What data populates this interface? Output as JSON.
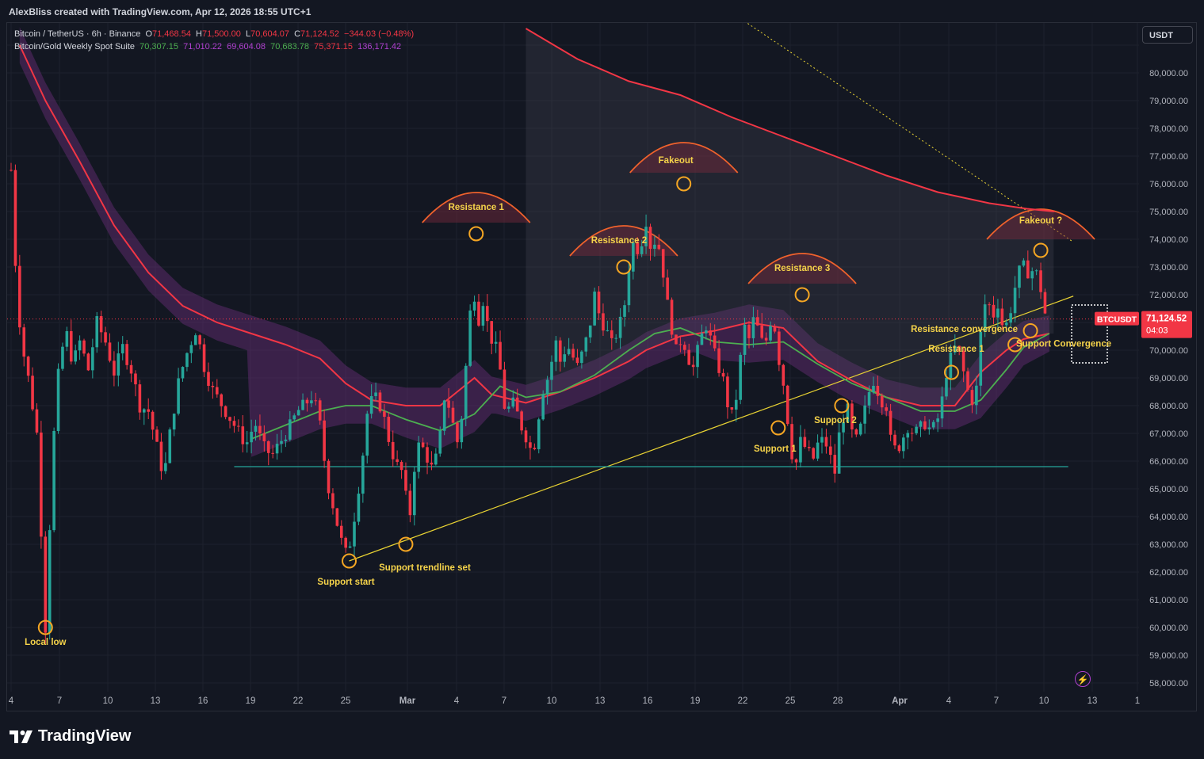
{
  "header": {
    "attribution": "AlexBliss created with TradingView.com, Apr 12, 2026 18:55 UTC+1"
  },
  "legend": {
    "symbol_line": "Bitcoin / TetherUS · 6h · Binance",
    "ohlc": {
      "o_label": "O",
      "o": "71,468.54",
      "h_label": "H",
      "h": "71,500.00",
      "l_label": "L",
      "l": "70,604.07",
      "c_label": "C",
      "c": "71,124.52",
      "change": "−344.03 (−0.48%)"
    },
    "indicator_name": "Bitcoin/Gold Weekly Spot Suite",
    "indicator_values": [
      "70,307.15",
      "71,010.22",
      "69,604.08",
      "70,683.78",
      "75,371.15",
      "136,171.42"
    ]
  },
  "currency_button": "USDT",
  "branding": "TradingView",
  "chart_data": {
    "type": "candlestick",
    "symbol": "BTCUSDT",
    "timeframe": "6h",
    "ylim": [
      57500,
      81700
    ],
    "y_ticks": [
      "58,000.00",
      "59,000.00",
      "60,000.00",
      "61,000.00",
      "62,000.00",
      "63,000.00",
      "64,000.00",
      "65,000.00",
      "66,000.00",
      "67,000.00",
      "68,000.00",
      "69,000.00",
      "70,000.00",
      "71,000.00",
      "72,000.00",
      "73,000.00",
      "74,000.00",
      "75,000.00",
      "76,000.00",
      "77,000.00",
      "78,000.00",
      "79,000.00",
      "80,000.00"
    ],
    "x_ticks": [
      "4",
      "7",
      "10",
      "13",
      "16",
      "19",
      "22",
      "25",
      "Mar",
      "4",
      "7",
      "10",
      "13",
      "16",
      "19",
      "22",
      "25",
      "28",
      "Apr",
      "4",
      "7",
      "10",
      "13",
      "1"
    ],
    "last_price": {
      "label": "BTCUSDT",
      "value": "71,124.52",
      "countdown": "04:03",
      "price": 71124.52
    },
    "close_path": [
      [
        4.0,
        76500
      ],
      [
        4.3,
        72500
      ],
      [
        4.6,
        70300
      ],
      [
        5.0,
        69000
      ],
      [
        5.5,
        67000
      ],
      [
        5.8,
        62800
      ],
      [
        6.0,
        60000
      ],
      [
        6.2,
        63000
      ],
      [
        6.5,
        67000
      ],
      [
        6.8,
        69500
      ],
      [
        7.2,
        70700
      ],
      [
        7.6,
        69500
      ],
      [
        8.0,
        70300
      ],
      [
        8.5,
        69300
      ],
      [
        9.0,
        71000
      ],
      [
        9.5,
        70300
      ],
      [
        10.0,
        69200
      ],
      [
        10.5,
        70100
      ],
      [
        11.0,
        69300
      ],
      [
        11.5,
        68000
      ],
      [
        12.0,
        67800
      ],
      [
        12.5,
        66500
      ],
      [
        12.9,
        65400
      ],
      [
        13.3,
        67200
      ],
      [
        13.8,
        69000
      ],
      [
        14.3,
        70000
      ],
      [
        14.8,
        70800
      ],
      [
        15.2,
        69500
      ],
      [
        15.7,
        68600
      ],
      [
        16.2,
        68100
      ],
      [
        16.7,
        67600
      ],
      [
        17.2,
        67100
      ],
      [
        17.7,
        66600
      ],
      [
        18.2,
        67400
      ],
      [
        18.7,
        66500
      ],
      [
        19.2,
        66200
      ],
      [
        19.7,
        66700
      ],
      [
        20.2,
        67200
      ],
      [
        20.7,
        67800
      ],
      [
        21.2,
        68100
      ],
      [
        21.6,
        68400
      ],
      [
        22.0,
        67300
      ],
      [
        22.4,
        65300
      ],
      [
        22.8,
        64300
      ],
      [
        23.2,
        63200
      ],
      [
        23.6,
        62500
      ],
      [
        24.0,
        64000
      ],
      [
        24.4,
        65700
      ],
      [
        24.8,
        68000
      ],
      [
        25.2,
        68300
      ],
      [
        25.6,
        67900
      ],
      [
        26.0,
        66800
      ],
      [
        26.4,
        65900
      ],
      [
        26.8,
        65600
      ],
      [
        27.2,
        63800
      ],
      [
        27.5,
        65800
      ],
      [
        27.8,
        66700
      ],
      [
        28.2,
        66200
      ],
      [
        28.6,
        65600
      ],
      [
        29.0,
        66900
      ],
      [
        29.3,
        68600
      ],
      [
        29.6,
        67700
      ],
      [
        30.0,
        66700
      ],
      [
        30.3,
        67800
      ],
      [
        30.6,
        70200
      ],
      [
        30.9,
        72500
      ],
      [
        31.2,
        71000
      ],
      [
        31.5,
        71800
      ],
      [
        31.8,
        70800
      ],
      [
        32.1,
        70200
      ],
      [
        32.4,
        69900
      ],
      [
        32.7,
        68000
      ],
      [
        33.0,
        67900
      ],
      [
        33.3,
        68100
      ],
      [
        33.7,
        67300
      ],
      [
        34.0,
        66900
      ],
      [
        34.4,
        66200
      ],
      [
        34.7,
        67500
      ],
      [
        35.0,
        68600
      ],
      [
        35.4,
        69200
      ],
      [
        35.7,
        70400
      ],
      [
        36.0,
        69600
      ],
      [
        36.4,
        70200
      ],
      [
        36.7,
        69800
      ],
      [
        37.0,
        69400
      ],
      [
        37.4,
        70100
      ],
      [
        37.7,
        70800
      ],
      [
        38.0,
        72000
      ],
      [
        38.3,
        71200
      ],
      [
        38.7,
        70700
      ],
      [
        39.0,
        70200
      ],
      [
        39.4,
        70800
      ],
      [
        39.7,
        71400
      ],
      [
        40.0,
        73000
      ],
      [
        40.3,
        74000
      ],
      [
        40.6,
        73500
      ],
      [
        41.0,
        74700
      ],
      [
        41.3,
        73600
      ],
      [
        41.6,
        74100
      ],
      [
        41.9,
        73300
      ],
      [
        42.2,
        71800
      ],
      [
        42.5,
        70800
      ],
      [
        42.8,
        69800
      ],
      [
        43.1,
        70600
      ],
      [
        43.4,
        69800
      ],
      [
        43.8,
        69300
      ],
      [
        44.1,
        70300
      ],
      [
        44.5,
        70900
      ],
      [
        44.8,
        70300
      ],
      [
        45.1,
        69600
      ],
      [
        45.5,
        68900
      ],
      [
        45.8,
        67900
      ],
      [
        46.1,
        67500
      ],
      [
        46.4,
        69100
      ],
      [
        46.7,
        70900
      ],
      [
        47.0,
        70400
      ],
      [
        47.3,
        71200
      ],
      [
        47.6,
        70600
      ],
      [
        47.9,
        70000
      ],
      [
        48.2,
        71100
      ],
      [
        48.5,
        70800
      ],
      [
        48.8,
        69400
      ],
      [
        49.1,
        68500
      ],
      [
        49.4,
        66500
      ],
      [
        49.7,
        65800
      ],
      [
        50.0,
        66700
      ],
      [
        50.4,
        66400
      ],
      [
        50.7,
        66000
      ],
      [
        51.0,
        66600
      ],
      [
        51.4,
        66800
      ],
      [
        51.7,
        66200
      ],
      [
        52.0,
        65600
      ],
      [
        52.3,
        67200
      ],
      [
        52.7,
        68000
      ],
      [
        53.0,
        67000
      ],
      [
        53.3,
        66700
      ],
      [
        53.7,
        67700
      ],
      [
        54.0,
        68500
      ],
      [
        54.3,
        69000
      ],
      [
        54.6,
        68300
      ],
      [
        55.0,
        68000
      ],
      [
        55.3,
        66500
      ],
      [
        55.6,
        66400
      ],
      [
        55.9,
        66700
      ],
      [
        56.2,
        67300
      ],
      [
        56.6,
        67000
      ],
      [
        56.9,
        67100
      ],
      [
        57.2,
        67400
      ],
      [
        57.6,
        67100
      ],
      [
        57.9,
        67300
      ],
      [
        58.2,
        68000
      ],
      [
        58.5,
        69200
      ],
      [
        58.8,
        69800
      ],
      [
        59.1,
        70200
      ],
      [
        59.4,
        69500
      ],
      [
        59.7,
        68600
      ],
      [
        60.0,
        68200
      ],
      [
        60.3,
        68700
      ],
      [
        60.6,
        71500
      ],
      [
        60.9,
        71800
      ],
      [
        61.2,
        71200
      ],
      [
        61.5,
        71700
      ],
      [
        61.8,
        70800
      ],
      [
        62.1,
        71000
      ],
      [
        62.4,
        72000
      ],
      [
        62.7,
        72800
      ],
      [
        63.0,
        73000
      ],
      [
        63.3,
        72800
      ],
      [
        63.6,
        72900
      ],
      [
        63.9,
        72600
      ],
      [
        64.2,
        71400
      ],
      [
        64.4,
        71124.52
      ]
    ],
    "series": [
      {
        "name": "Bitcoin/Gold Weekly Spot Suite",
        "color": "#f23645",
        "points": [
          [
            4.5,
            81000
          ],
          [
            6,
            79000
          ],
          [
            8,
            76800
          ],
          [
            10,
            74500
          ],
          [
            12,
            72800
          ],
          [
            14,
            71600
          ],
          [
            16,
            71000
          ],
          [
            18,
            70600
          ],
          [
            20,
            70200
          ],
          [
            22,
            69700
          ],
          [
            23.5,
            68800
          ],
          [
            25,
            68200
          ],
          [
            27,
            68000
          ],
          [
            29,
            68000
          ],
          [
            30,
            68500
          ],
          [
            31,
            69000
          ],
          [
            32,
            68400
          ],
          [
            34,
            68100
          ],
          [
            36,
            68500
          ],
          [
            38,
            69000
          ],
          [
            40,
            69600
          ],
          [
            41,
            70000
          ],
          [
            43,
            70500
          ],
          [
            45,
            70700
          ],
          [
            47,
            71000
          ],
          [
            49,
            70800
          ],
          [
            51,
            69600
          ],
          [
            53,
            68900
          ],
          [
            55,
            68300
          ],
          [
            57,
            68000
          ],
          [
            59,
            68000
          ],
          [
            60.5,
            69200
          ],
          [
            62,
            70000
          ],
          [
            63,
            70400
          ],
          [
            64.5,
            70600
          ]
        ]
      },
      {
        "color": "#4caf50",
        "points": [
          [
            18,
            66800
          ],
          [
            20,
            67300
          ],
          [
            22,
            67800
          ],
          [
            23.5,
            68000
          ],
          [
            25,
            68000
          ],
          [
            27,
            67500
          ],
          [
            29,
            67100
          ],
          [
            31,
            67700
          ],
          [
            32.5,
            68700
          ],
          [
            34,
            68300
          ],
          [
            36,
            68500
          ],
          [
            38,
            69100
          ],
          [
            40,
            70000
          ],
          [
            41.5,
            70600
          ],
          [
            43,
            70800
          ],
          [
            45,
            70300
          ],
          [
            47,
            70200
          ],
          [
            49,
            70300
          ],
          [
            51,
            69500
          ],
          [
            53,
            68800
          ],
          [
            55,
            68300
          ],
          [
            57,
            67800
          ],
          [
            59,
            67800
          ],
          [
            60.5,
            68200
          ],
          [
            62,
            69300
          ],
          [
            63,
            70100
          ],
          [
            64.5,
            70600
          ]
        ]
      },
      {
        "color": "#f23645",
        "points": [
          [
            34,
            81600
          ],
          [
            37,
            80500
          ],
          [
            40,
            79700
          ],
          [
            43,
            79200
          ],
          [
            46,
            78400
          ],
          [
            49,
            77700
          ],
          [
            52,
            77000
          ],
          [
            55,
            76300
          ],
          [
            58,
            75700
          ],
          [
            61,
            75300
          ],
          [
            63.2,
            75100
          ],
          [
            64.8,
            75000
          ]
        ]
      }
    ],
    "trendlines": [
      {
        "from": [
          23.7,
          62400
        ],
        "to": [
          65.9,
          71950
        ],
        "color": "#e8d233"
      },
      {
        "from": [
          17.0,
          65800
        ],
        "to": [
          65.6,
          65800
        ],
        "color": "#26a69a"
      },
      {
        "from": [
          45.2,
          82500
        ],
        "to": [
          65.9,
          73900
        ],
        "color": "#e8d233",
        "dashed": true
      }
    ],
    "markers": [
      {
        "x": 6.0,
        "y": 60000,
        "label": "Local low"
      },
      {
        "x": 23.7,
        "y": 62400,
        "label": "Support start"
      },
      {
        "x": 27.0,
        "y": 63000,
        "label": "Support trendline set"
      },
      {
        "x": 31.1,
        "y": 74200,
        "label": "Resistance 1"
      },
      {
        "x": 39.7,
        "y": 73000,
        "label": "Resistance 2"
      },
      {
        "x": 43.2,
        "y": 76000,
        "label": "Fakeout"
      },
      {
        "x": 50.1,
        "y": 72000,
        "label": "Resistance 3"
      },
      {
        "x": 48.7,
        "y": 67200,
        "label": "Support 1"
      },
      {
        "x": 52.4,
        "y": 68000,
        "label": "Support 2"
      },
      {
        "x": 58.8,
        "y": 69200,
        "label": "Resistance 1"
      },
      {
        "x": 62.5,
        "y": 70200,
        "label": "Resistance convergence"
      },
      {
        "x": 63.4,
        "y": 70700,
        "label": "Support Convergence"
      },
      {
        "x": 64.0,
        "y": 73600,
        "label": "Fakeout ?"
      }
    ]
  }
}
